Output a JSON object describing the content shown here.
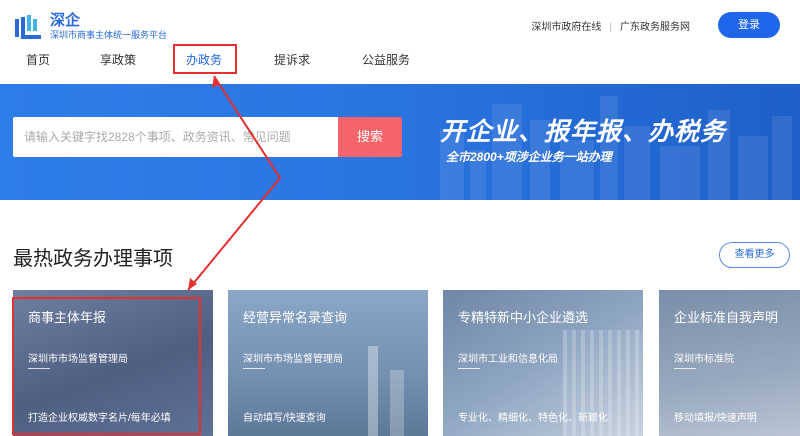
{
  "header": {
    "logo_title": "深企",
    "logo_subtitle": "深圳市商事主体统一服务平台",
    "links": [
      "深圳市政府在线",
      "广东政务服务网"
    ],
    "login_label": "登录"
  },
  "nav": {
    "items": [
      "首页",
      "享政策",
      "办政务",
      "提诉求",
      "公益服务"
    ],
    "active": "办政务"
  },
  "banner": {
    "search_placeholder": "请输入关键字找2828个事项、政务资讯、常见问题",
    "search_button": "搜索",
    "slogan": "开企业、报年报、办税务",
    "slogan_sub": "全市2800+项涉企业务一站办理"
  },
  "section": {
    "title": "最热政务办理事项",
    "more_label": "查看更多"
  },
  "cards": [
    {
      "title": "商事主体年报",
      "org": "深圳市市场监督管理局",
      "desc": "打造企业权威数字名片/每年必填"
    },
    {
      "title": "经营异常名录查询",
      "org": "深圳市市场监督管理局",
      "desc": "自动填写/快速查询"
    },
    {
      "title": "专精特新中小企业遴选",
      "org": "深圳市工业和信息化局",
      "desc": "专业化、精细化、特色化、新颖化"
    },
    {
      "title": "企业标准自我声明",
      "org": "深圳市标准院",
      "desc": "移动填报/快速声明"
    }
  ],
  "colors": {
    "brand": "#1f66ea",
    "search_button": "#f4646a",
    "annotation": "#e53030"
  }
}
